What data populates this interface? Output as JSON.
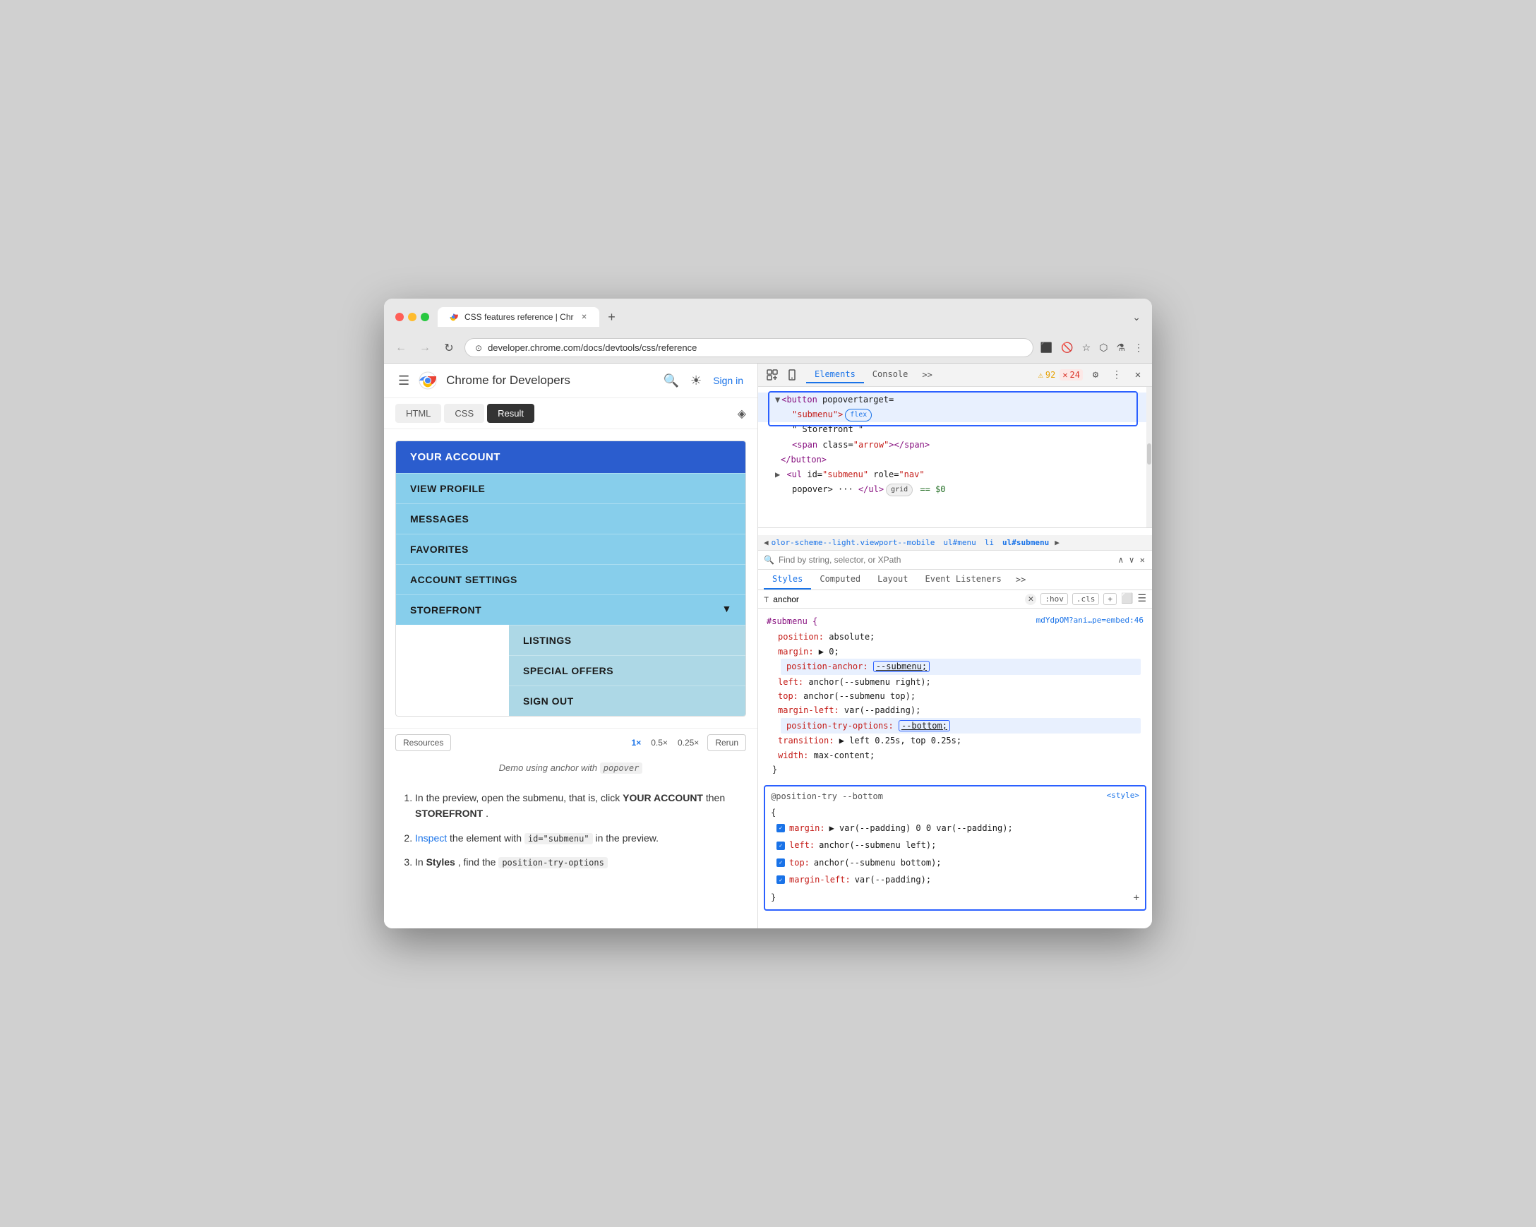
{
  "browser": {
    "tab_title": "CSS features reference | Chr",
    "url": "developer.chrome.com/docs/devtools/css/reference",
    "back_enabled": true,
    "forward_enabled": false
  },
  "site_header": {
    "title": "Chrome for Developers",
    "sign_in": "Sign in"
  },
  "code_tabs": {
    "tabs": [
      "HTML",
      "CSS",
      "Result"
    ],
    "active": "Result"
  },
  "demo": {
    "resources_label": "Resources",
    "zoom_options": [
      "1×",
      "0.5×",
      "0.25×"
    ],
    "active_zoom": "1×",
    "rerun_label": "Rerun",
    "caption": "Demo using anchor with  popover"
  },
  "nav_menu": {
    "your_account": "YOUR ACCOUNT",
    "items": [
      "VIEW PROFILE",
      "MESSAGES",
      "FAVORITES",
      "ACCOUNT SETTINGS"
    ],
    "storefront": "STOREFRONT",
    "submenu_items": [
      "LISTINGS",
      "SPECIAL OFFERS",
      "SIGN OUT"
    ]
  },
  "page_steps": {
    "step1": "In the preview, open the submenu, that is, click ",
    "step1_bold1": "YOUR ACCOUNT",
    "step1_then": " then ",
    "step1_bold2": "STOREFRONT",
    "step1_end": ".",
    "step2_link": "Inspect",
    "step2_text": " the element with ",
    "step2_code": "id=\"submenu\"",
    "step2_end": " in the preview.",
    "step3": "In ",
    "step3_bold": "Styles",
    "step3_end": ", find the ",
    "step3_code": "position-try-options"
  },
  "devtools": {
    "tools": [
      "cursor-icon",
      "inspect-icon"
    ],
    "tabs": [
      "Elements",
      "Console",
      "more-tabs"
    ],
    "active_tab": "Elements",
    "warning_count": "92",
    "error_count": "24",
    "html_tree": {
      "lines": [
        {
          "indent": 0,
          "content": "<button popovertarget=",
          "highlighted": true
        },
        {
          "indent": 1,
          "content": "\"submenu\">",
          "badge": "flex",
          "highlighted": true
        },
        {
          "indent": 2,
          "content": "\" Storefront \""
        },
        {
          "indent": 2,
          "content": "<span class=\"arrow\"></span>"
        },
        {
          "indent": 1,
          "content": "</button>"
        },
        {
          "indent": 0,
          "content": "▶ <ul id=\"submenu\" role=\"nav\""
        },
        {
          "indent": 2,
          "content": "popover> ··· </ul>",
          "badge": "grid",
          "dollar": "== $0"
        }
      ]
    },
    "breadcrumb": [
      "olor-scheme--light.viewport--mobile",
      "ul#menu",
      "li",
      "ul#submenu"
    ],
    "search_placeholder": "Find by string, selector, or XPath",
    "styles_tabs": [
      "Styles",
      "Computed",
      "Layout",
      "Event Listeners",
      "more"
    ],
    "active_styles_tab": "Styles",
    "filter_placeholder": "anchor",
    "filter_badges": [
      ":hov",
      ".cls",
      "+"
    ],
    "css_block": {
      "selector": "#submenu {",
      "source": "mdYdpOM?ani…pe=embed:46",
      "properties": [
        {
          "prop": "position:",
          "val": "absolute;"
        },
        {
          "prop": "margin:",
          "val": "▶ 0;"
        },
        {
          "prop": "position-anchor:",
          "val": "--submenu;",
          "highlight": true,
          "boxed": true
        },
        {
          "prop": "left:",
          "val": "anchor(--submenu right);"
        },
        {
          "prop": "top:",
          "val": "anchor(--submenu top);"
        },
        {
          "prop": "margin-left:",
          "val": "var(--padding);"
        },
        {
          "prop": "position-try-options:",
          "val": "--bottom;",
          "highlight": true,
          "boxed_val": true
        },
        {
          "prop": "transition:",
          "val": "▶ left 0.25s, top 0.25s;"
        },
        {
          "prop": "width:",
          "val": "max-content;"
        }
      ]
    },
    "position_try_block": {
      "selector": "@position-try --bottom",
      "source": "<style>",
      "props": [
        "margin: ▶ var(--padding) 0 0 var(--padding);",
        "left: anchor(--submenu left);",
        "top: anchor(--submenu bottom);",
        "margin-left: var(--padding);"
      ]
    }
  }
}
